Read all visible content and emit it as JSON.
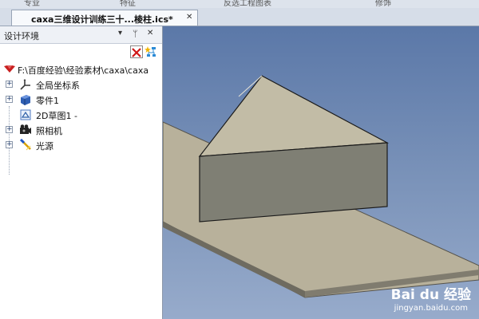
{
  "menu": {
    "items": [
      "专业",
      "特征",
      "反选工程图表",
      "修饰"
    ]
  },
  "document_tab": {
    "title": "caxa三维设计训练三十...棱柱.ics*",
    "close_glyph": "✕"
  },
  "panel": {
    "title": "设计环境",
    "dropdown_glyph": "▾",
    "pin_glyph": "ᵖ",
    "close_glyph": "✕",
    "tree": {
      "root": "F:\\百度经验\\经验素材\\caxa\\caxa",
      "items": [
        {
          "label": "全局坐标系",
          "icon": "axes-icon",
          "expander": "+"
        },
        {
          "label": "零件1",
          "icon": "part-icon",
          "expander": "+"
        },
        {
          "label": "2D草图1 -",
          "icon": "sketch-icon",
          "expander": ""
        },
        {
          "label": "照相机",
          "icon": "camera-icon",
          "expander": "+"
        },
        {
          "label": "光源",
          "icon": "light-icon",
          "expander": "+"
        }
      ]
    }
  },
  "viewport": {
    "background_top": "#5b78a8",
    "background_bottom": "#97abcb",
    "plate_color": "#b8b19b",
    "prism_top_color": "#c2bca6",
    "prism_front_color": "#7f7f74"
  },
  "watermark": {
    "logo": "Bai du 经验",
    "url": "jingyan.baidu.com"
  }
}
